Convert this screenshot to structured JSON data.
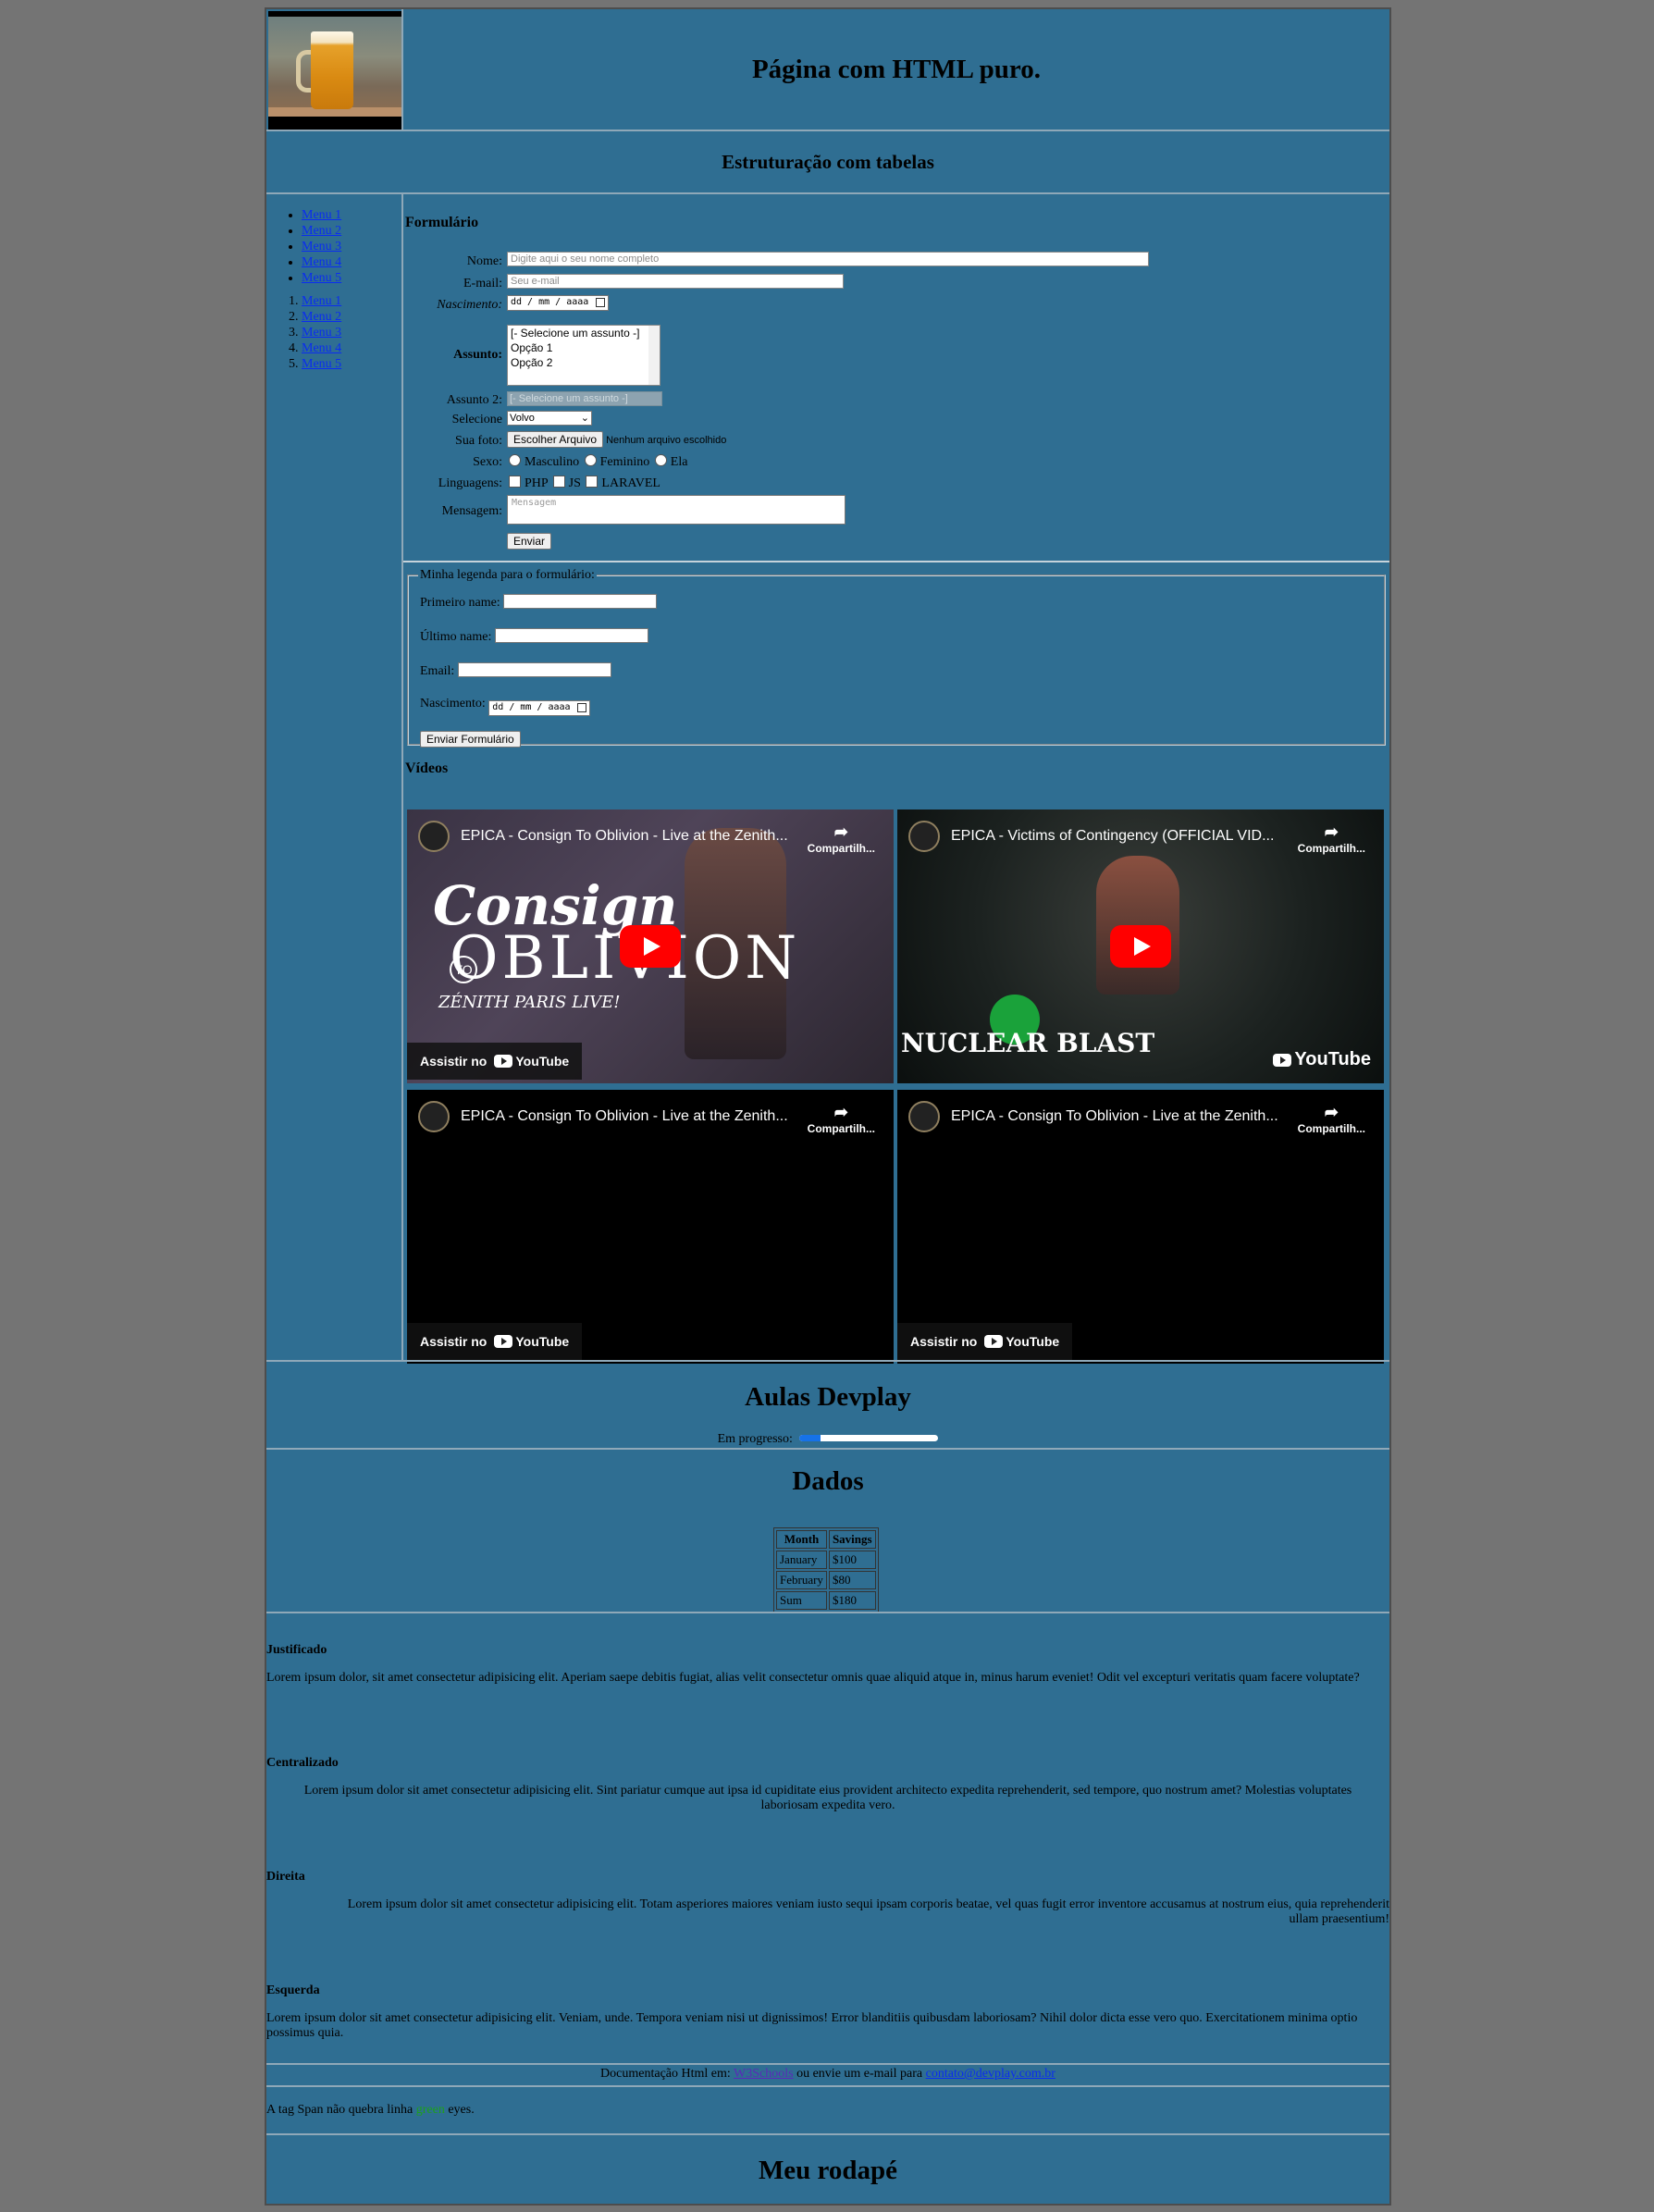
{
  "header": {
    "title": "Página com HTML puro.",
    "subtitle": "Estruturação com tabelas"
  },
  "sidebar": {
    "unordered": [
      "Menu 1",
      "Menu 2",
      "Menu 3",
      "Menu 4",
      "Menu 5"
    ],
    "ordered": [
      "Menu 1",
      "Menu 2",
      "Menu 3",
      "Menu 4",
      "Menu 5"
    ]
  },
  "form": {
    "title": "Formulário",
    "nome_label": "Nome:",
    "nome_placeholder": "Digite aqui o seu nome completo",
    "email_label": "E-mail:",
    "email_placeholder": "Seu e-mail",
    "nascimento_label": "Nascimento:",
    "date_placeholder": "dd / mm / aaaa",
    "assunto_label": "Assunto:",
    "assunto_options": [
      "[- Selecione um assunto -]",
      "Opção 1",
      "Opção 2"
    ],
    "assunto2_label": "Assunto 2:",
    "assunto2_value": "[- Selecione um assunto -]",
    "selecione_label": "Selecione",
    "selecione_value": "Volvo",
    "foto_label": "Sua foto:",
    "foto_button": "Escolher Arquivo",
    "foto_status": "Nenhum arquivo escolhido",
    "sexo_label": "Sexo:",
    "sexo_options": [
      "Masculino",
      "Feminino",
      "Ela"
    ],
    "linguagens_label": "Linguagens:",
    "linguagens_options": [
      "PHP",
      "JS",
      "LARAVEL"
    ],
    "mensagem_label": "Mensagem:",
    "mensagem_placeholder": "Mensagem",
    "submit": "Enviar"
  },
  "fieldset": {
    "legend": "Minha legenda para o formulário:",
    "primeiro": "Primeiro name:",
    "ultimo": "Último name:",
    "email": "Email:",
    "nascimento": "Nascimento:",
    "date_placeholder": "dd / mm / aaaa",
    "submit": "Enviar Formulário"
  },
  "videos": {
    "title": "Vídeos",
    "share_label": "Compartilh...",
    "watch_label": "Assistir no",
    "youtube": "YouTube",
    "items": [
      {
        "title": "EPICA - Consign To Oblivion - Live at the Zenith...",
        "art_line1": "Consign",
        "art_line2": "OBLIVION",
        "art_line3": "ZÉNITH PARIS LIVE!",
        "art_to": "TO"
      },
      {
        "title": "EPICA - Victims of Contingency (OFFICIAL VID...",
        "art_line1": "NUCLEAR BLAST"
      },
      {
        "title": "EPICA - Consign To Oblivion - Live at the Zenith..."
      },
      {
        "title": "EPICA - Consign To Oblivion - Live at the Zenith..."
      }
    ]
  },
  "devplay": {
    "title": "Aulas Devplay",
    "progress_label": "Em progresso:",
    "progress_value": 0.15
  },
  "dados": {
    "title": "Dados",
    "headers": [
      "Month",
      "Savings"
    ],
    "rows": [
      [
        "January",
        "$100"
      ],
      [
        "February",
        "$80"
      ],
      [
        "Sum",
        "$180"
      ]
    ]
  },
  "texts": {
    "justificado_title": "Justificado",
    "justificado": "Lorem ipsum dolor, sit amet consectetur adipisicing elit. Aperiam saepe debitis fugiat, alias velit consectetur omnis quae aliquid atque in, minus harum eveniet! Odit vel excepturi veritatis quam facere voluptate?",
    "centralizado_title": "Centralizado",
    "centralizado": "Lorem ipsum dolor sit amet consectetur adipisicing elit. Sint pariatur cumque aut ipsa id cupiditate eius provident architecto expedita reprehenderit, sed tempore, quo nostrum amet? Molestias voluptates laboriosam expedita vero.",
    "direita_title": "Direita",
    "direita": "Lorem ipsum dolor sit amet consectetur adipisicing elit. Totam asperiores maiores veniam iusto sequi ipsam corporis beatae, vel quas fugit error inventore accusamus at nostrum eius, quia reprehenderit ullam praesentium!",
    "esquerda_title": "Esquerda",
    "esquerda": "Lorem ipsum dolor sit amet consectetur adipisicing elit. Veniam, unde. Tempora veniam nisi ut dignissimos! Error blanditiis quibusdam laboriosam? Nihil dolor dicta esse vero quo. Exercitationem minima optio possimus quia."
  },
  "doc": {
    "prefix": "Documentação Html em:",
    "link1": "W3Schools",
    "middle": "ou envie um e-mail para",
    "link2": "contato@devplay.com.br"
  },
  "span": {
    "before": "A tag Span não quebra linha",
    "green": "green",
    "after": "eyes."
  },
  "footer": {
    "title": "Meu rodapé"
  }
}
